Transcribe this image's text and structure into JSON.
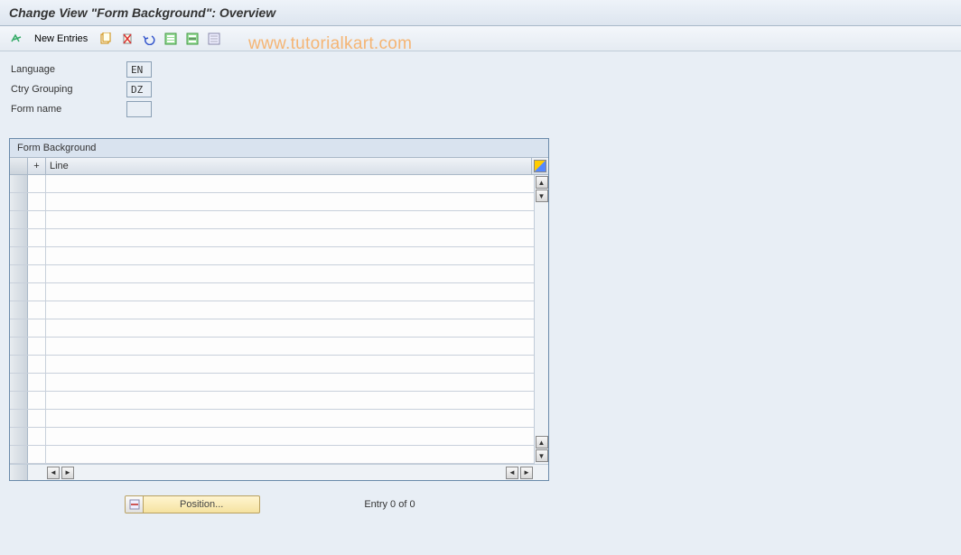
{
  "title": "Change View \"Form Background\": Overview",
  "toolbar": {
    "new_entries": "New Entries"
  },
  "fields": {
    "language_label": "Language",
    "language_value": "EN",
    "ctry_label": "Ctry Grouping",
    "ctry_value": "DZ",
    "form_label": "Form name",
    "form_value": ""
  },
  "table": {
    "title": "Form Background",
    "col_plus": "+",
    "col_line": "Line",
    "rows": [
      "",
      "",
      "",
      "",
      "",
      "",
      "",
      "",
      "",
      "",
      "",
      "",
      "",
      "",
      "",
      ""
    ]
  },
  "footer": {
    "position_label": "Position...",
    "entry_text": "Entry 0 of 0"
  },
  "watermark": "www.tutorialkart.com"
}
